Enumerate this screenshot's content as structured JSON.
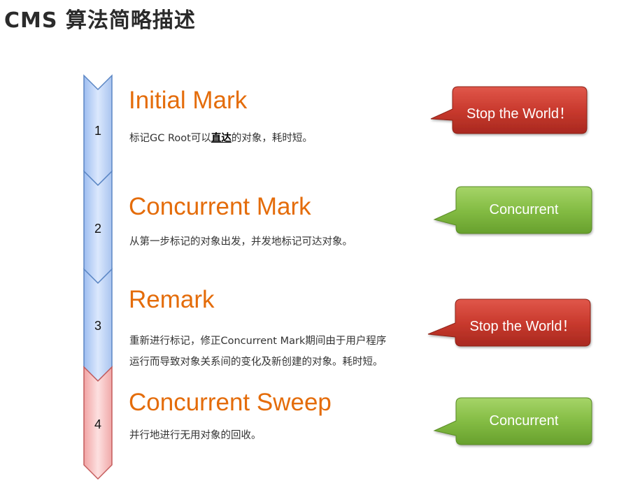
{
  "title": "CMS  算法简略描述",
  "steps": [
    {
      "number": "1",
      "title": "Initial Mark",
      "desc_lines": [],
      "desc_pre": "标记GC Root可以",
      "desc_emph": "直达",
      "desc_post": "的对象，耗时短。",
      "badge": "Stop the World！",
      "badge_type": "stop"
    },
    {
      "number": "2",
      "title": "Concurrent Mark",
      "desc_lines": [
        "从第一步标记的对象出发，并发地标记可达对象。"
      ],
      "badge": "Concurrent",
      "badge_type": "concurrent"
    },
    {
      "number": "3",
      "title": "Remark",
      "desc_lines": [
        "重新进行标记，修正Concurrent Mark期间由于用户程序",
        "运行而导致对象关系间的变化及新创建的对象。耗时短。"
      ],
      "badge": "Stop the World！",
      "badge_type": "stop"
    },
    {
      "number": "4",
      "title": "Concurrent Sweep",
      "desc_lines": [
        "并行地进行无用对象的回收。"
      ],
      "badge": "Concurrent",
      "badge_type": "concurrent"
    }
  ],
  "colors": {
    "title_orange": "#e46c0a",
    "chevron_blue": "#cfe0fb",
    "chevron_blue_border": "#5b86c4",
    "chevron_red": "#f8c7c7",
    "chevron_red_border": "#c45b5b",
    "stop_red": "#c0392b",
    "concurrent_green": "#7cb342"
  }
}
